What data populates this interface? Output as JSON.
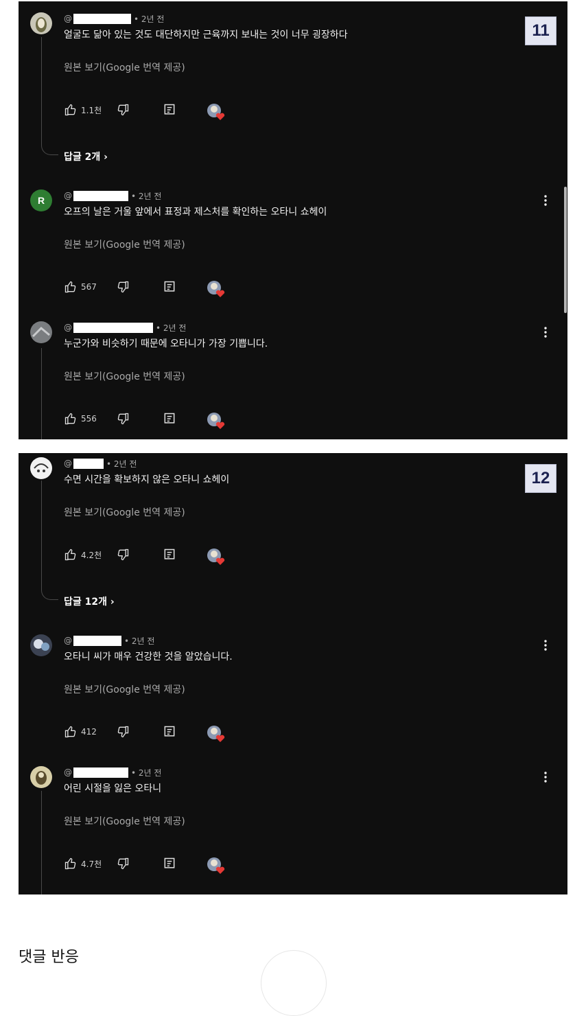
{
  "panels": [
    {
      "badge": "11",
      "comments": [
        {
          "handle": "@",
          "time": "• 2년 전",
          "text": "얼굴도 닮아 있는 것도 대단하지만 근육까지 보내는 것이 너무 굉장하다",
          "translate": "원본 보기(Google 번역 제공)",
          "likes": "1.1천",
          "replies": "답글 2개 ›"
        },
        {
          "avatar_letter": "R",
          "handle": "@",
          "time": "• 2년 전",
          "text": "오프의 날은 거울 앞에서 표정과 제스처를 확인하는 오타니 쇼헤이",
          "translate": "원본 보기(Google 번역 제공)",
          "likes": "567"
        },
        {
          "handle": "@",
          "time": "• 2년 전",
          "text": "누군가와 비슷하기 때문에 오타니가 가장 기쁩니다.",
          "translate": "원본 보기(Google 번역 제공)",
          "likes": "556"
        }
      ]
    },
    {
      "badge": "12",
      "comments": [
        {
          "handle": "@",
          "time": "• 2년 전",
          "text": "수면 시간을 확보하지 않은 오타니 쇼헤이",
          "translate": "원본 보기(Google 번역 제공)",
          "likes": "4.2천",
          "replies": "답글 12개 ›"
        },
        {
          "handle": "@",
          "time": "• 2년 전",
          "text": "오타니 씨가 매우 건강한 것을 알았습니다.",
          "translate": "원본 보기(Google 번역 제공)",
          "likes": "412"
        },
        {
          "handle": "@",
          "time": "• 2년 전",
          "text": "어린 시절을 잃은 오타니",
          "translate": "원본 보기(Google 번역 제공)",
          "likes": "4.7천"
        }
      ]
    }
  ],
  "footer": {
    "title": "댓글 반응"
  },
  "icons": [
    "like-icon",
    "dislike-icon",
    "reply-icon",
    "creator-heart-icon",
    "more-vert-icon"
  ],
  "colors": {
    "background": "#0f0f0f",
    "text": "#f1f1f1",
    "secondary_text": "#aaaaaa",
    "heart": "#e53935",
    "badge_bg": "#e4e6f2",
    "badge_text": "#1b2150"
  }
}
